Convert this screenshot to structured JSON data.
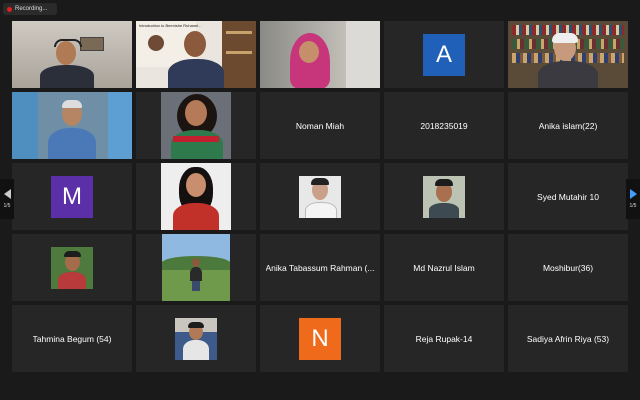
{
  "recording": {
    "label": "Recording..."
  },
  "pager": {
    "left_page": "1/5",
    "right_page": "1/5"
  },
  "colors": {
    "active_border": "#d8e35a",
    "tile_bg": "#262626",
    "avatar_a": "#2060b8",
    "avatar_m": "#5b2fa8",
    "avatar_n": "#f06a1c"
  },
  "participants": {
    "noman": "Noman Miah",
    "id_2018": "2018235019",
    "anika": "Anika islam(22)",
    "syed": "Syed Mutahir 10",
    "anika_t": "Anika Tabassum Rahman (...",
    "nazrul": "Md Nazrul Islam",
    "moshibur": "Moshibur(36)",
    "tahmina": "Tahmina Begum (54)",
    "reja": "Reja Rupak-14",
    "sadiya": "Sadiya Afrin Riya (53)"
  },
  "avatars": {
    "a": "A",
    "m": "M",
    "n": "N"
  },
  "poster_text": "Introduction to Beenishe Ruhanel..."
}
